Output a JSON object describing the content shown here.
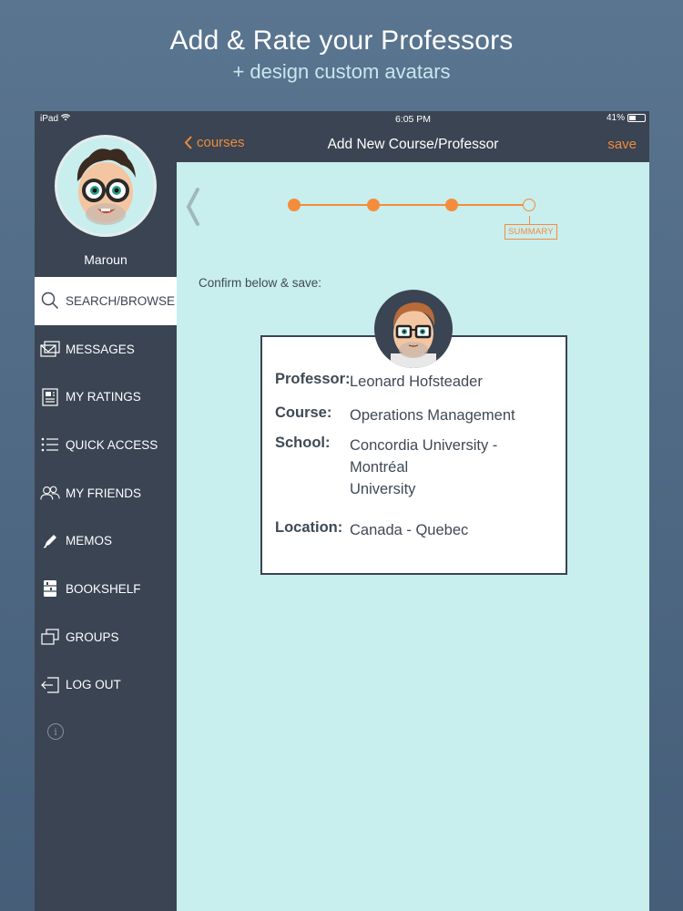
{
  "promo": {
    "headline": "Add & Rate your Professors",
    "subhead": "+ design custom avatars"
  },
  "status_bar": {
    "device": "iPad",
    "time": "6:05 PM",
    "battery": "41%",
    "battery_level": 0.41
  },
  "sidebar": {
    "user_name": "Maroun",
    "items": [
      {
        "label": "SEARCH/BROWSE",
        "icon": "search-icon",
        "active": true
      },
      {
        "label": "MESSAGES",
        "icon": "envelope-icon"
      },
      {
        "label": "MY RATINGS",
        "icon": "document-icon"
      },
      {
        "label": "QUICK ACCESS",
        "icon": "list-icon"
      },
      {
        "label": "MY FRIENDS",
        "icon": "friends-icon"
      },
      {
        "label": "MEMOS",
        "icon": "pen-icon"
      },
      {
        "label": "BOOKSHELF",
        "icon": "bookshelf-icon"
      },
      {
        "label": "GROUPS",
        "icon": "groups-icon"
      },
      {
        "label": "LOG OUT",
        "icon": "logout-icon"
      }
    ],
    "info_icon": "i"
  },
  "navbar": {
    "back_label": "courses",
    "title": "Add New Course/Professor",
    "save_label": "save"
  },
  "stepper": {
    "total_steps": 4,
    "current_step": 4,
    "current_label": "SUMMARY"
  },
  "confirm": {
    "prompt": "Confirm below & save:",
    "professor_label": "Professor:",
    "professor_value": "Leonard Hofsteader",
    "course_label": "Course:",
    "course_value": "Operations Management",
    "school_label": "School:",
    "school_value_line1": "Concordia University -",
    "school_value_line2": "Montréal",
    "school_value_line3": "University",
    "location_label": "Location:",
    "location_value": "Canada - Quebec"
  },
  "colors": {
    "accent": "#f58c3c",
    "sidebar_bg": "#3a4452",
    "content_bg": "#c8eeee"
  }
}
